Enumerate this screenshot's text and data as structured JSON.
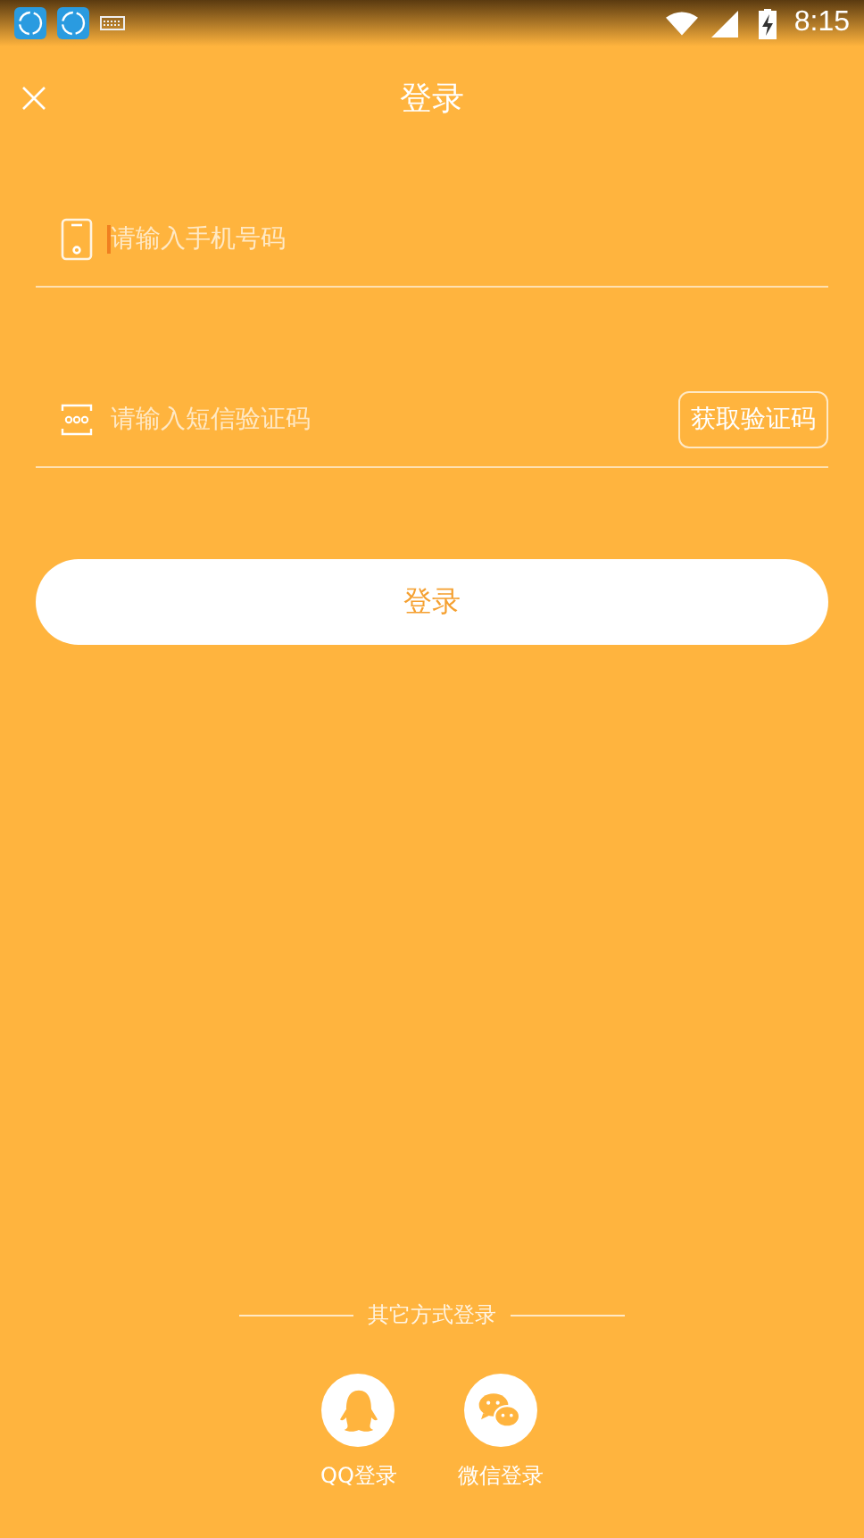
{
  "status_bar": {
    "time": "8:15"
  },
  "header": {
    "title": "登录"
  },
  "phone_field": {
    "placeholder": "请输入手机号码",
    "focused": true
  },
  "code_field": {
    "placeholder": "请输入短信验证码",
    "button": "获取验证码"
  },
  "login_button": "登录",
  "other_login": {
    "label": "其它方式登录",
    "providers": [
      {
        "kind": "qq",
        "label": "QQ登录"
      },
      {
        "kind": "wechat",
        "label": "微信登录"
      }
    ]
  }
}
